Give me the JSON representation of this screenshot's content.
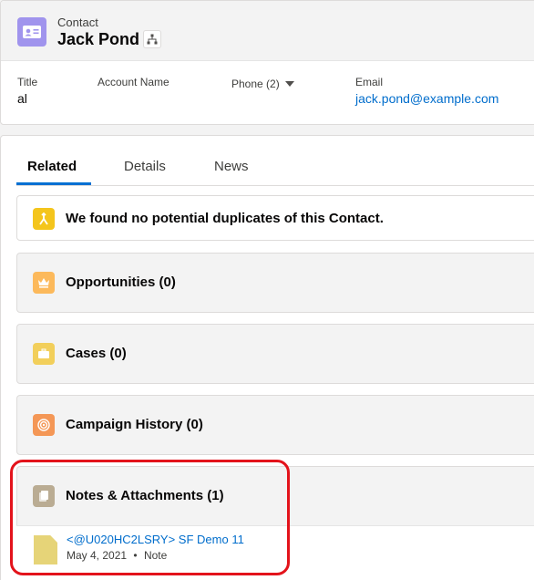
{
  "header": {
    "object_label": "Contact",
    "record_name": "Jack Pond",
    "fields": {
      "title_label": "Title",
      "title_value": "al",
      "account_label": "Account Name",
      "phone_label": "Phone (2)",
      "email_label": "Email",
      "email_value": "jack.pond@example.com"
    }
  },
  "tabs": [
    {
      "label": "Related",
      "active": true
    },
    {
      "label": "Details",
      "active": false
    },
    {
      "label": "News",
      "active": false
    }
  ],
  "related": {
    "duplicates_msg": "We found no potential duplicates of this Contact.",
    "opportunities": "Opportunities (0)",
    "cases": "Cases (0)",
    "campaign_history": "Campaign History (0)",
    "notes_attachments": "Notes & Attachments (1)",
    "note": {
      "title": "<@U020HC2LSRY> SF Demo 11",
      "date": "May 4, 2021",
      "separator": "•",
      "type": "Note"
    }
  },
  "colors": {
    "contact_icon": "#a094ed",
    "duplicate_icon": "#f4c51c",
    "opportunity_icon": "#fcb95b",
    "case_icon": "#f2cf5b",
    "campaign_icon": "#f49756",
    "notes_icon": "#baac93",
    "link": "#006dcc",
    "tab_active": "#0070d2",
    "highlight": "#e3131b"
  },
  "icons": {
    "contact": "contact-card-icon",
    "hierarchy": "hierarchy-icon",
    "duplicates": "merge-icon",
    "opportunities": "crown-icon",
    "cases": "briefcase-icon",
    "campaign": "target-icon",
    "notes": "files-icon",
    "note": "note-icon"
  }
}
